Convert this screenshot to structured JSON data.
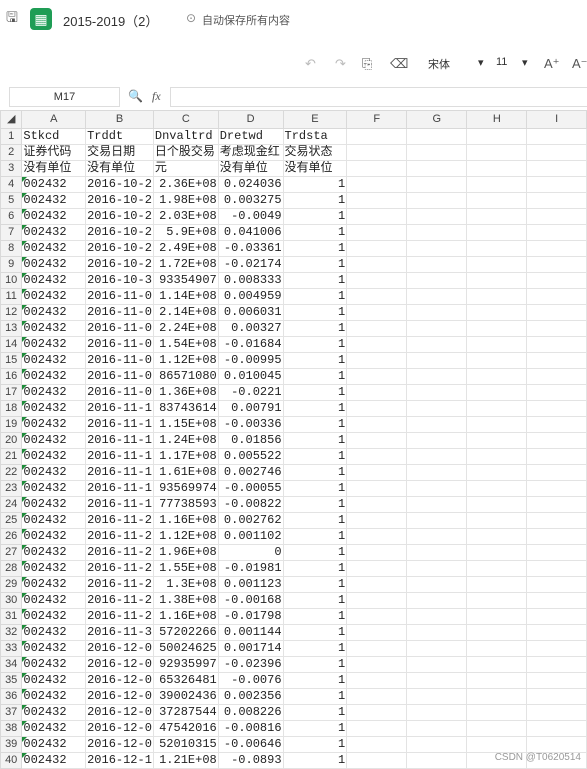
{
  "titlebar": {
    "doc_title": "2015-2019（2）",
    "autosave": "自动保存所有内容"
  },
  "toolbar": {
    "font_name": "宋体",
    "font_size": "11"
  },
  "formula": {
    "cell_ref": "M17",
    "fx": "fx"
  },
  "columns": [
    "A",
    "B",
    "C",
    "D",
    "E",
    "F",
    "G",
    "H",
    "I"
  ],
  "rows": [
    {
      "n": "1",
      "a": "Stkcd",
      "b": "Trddt",
      "c": "Dnvaltrd",
      "d": "Dretwd",
      "e": "Trdsta"
    },
    {
      "n": "2",
      "a": "证券代码",
      "b": "交易日期",
      "c": "日个股交易",
      "d": "考虑现金红",
      "e": "交易状态"
    },
    {
      "n": "3",
      "a": "没有单位",
      "b": "没有单位",
      "c": "元",
      "d": "没有单位",
      "e": "没有单位"
    },
    {
      "n": "4",
      "a": "002432",
      "b": "2016-10-2",
      "c": "2.36E+08",
      "d": "0.024036",
      "e": "1"
    },
    {
      "n": "5",
      "a": "002432",
      "b": "2016-10-2",
      "c": "1.98E+08",
      "d": "0.003275",
      "e": "1"
    },
    {
      "n": "6",
      "a": "002432",
      "b": "2016-10-2",
      "c": "2.03E+08",
      "d": "-0.0049",
      "e": "1"
    },
    {
      "n": "7",
      "a": "002432",
      "b": "2016-10-2",
      "c": "5.9E+08",
      "d": "0.041006",
      "e": "1"
    },
    {
      "n": "8",
      "a": "002432",
      "b": "2016-10-2",
      "c": "2.49E+08",
      "d": "-0.03361",
      "e": "1"
    },
    {
      "n": "9",
      "a": "002432",
      "b": "2016-10-2",
      "c": "1.72E+08",
      "d": "-0.02174",
      "e": "1"
    },
    {
      "n": "10",
      "a": "002432",
      "b": "2016-10-3",
      "c": "93354907",
      "d": "0.008333",
      "e": "1"
    },
    {
      "n": "11",
      "a": "002432",
      "b": "2016-11-0",
      "c": "1.14E+08",
      "d": "0.004959",
      "e": "1"
    },
    {
      "n": "12",
      "a": "002432",
      "b": "2016-11-0",
      "c": "2.14E+08",
      "d": "0.006031",
      "e": "1"
    },
    {
      "n": "13",
      "a": "002432",
      "b": "2016-11-0",
      "c": "2.24E+08",
      "d": "0.00327",
      "e": "1"
    },
    {
      "n": "14",
      "a": "002432",
      "b": "2016-11-0",
      "c": "1.54E+08",
      "d": "-0.01684",
      "e": "1"
    },
    {
      "n": "15",
      "a": "002432",
      "b": "2016-11-0",
      "c": "1.12E+08",
      "d": "-0.00995",
      "e": "1"
    },
    {
      "n": "16",
      "a": "002432",
      "b": "2016-11-0",
      "c": "86571080",
      "d": "0.010045",
      "e": "1"
    },
    {
      "n": "17",
      "a": "002432",
      "b": "2016-11-0",
      "c": "1.36E+08",
      "d": "-0.0221",
      "e": "1"
    },
    {
      "n": "18",
      "a": "002432",
      "b": "2016-11-1",
      "c": "83743614",
      "d": "0.00791",
      "e": "1"
    },
    {
      "n": "19",
      "a": "002432",
      "b": "2016-11-1",
      "c": "1.15E+08",
      "d": "-0.00336",
      "e": "1"
    },
    {
      "n": "20",
      "a": "002432",
      "b": "2016-11-1",
      "c": "1.24E+08",
      "d": "0.01856",
      "e": "1"
    },
    {
      "n": "21",
      "a": "002432",
      "b": "2016-11-1",
      "c": "1.17E+08",
      "d": "0.005522",
      "e": "1"
    },
    {
      "n": "22",
      "a": "002432",
      "b": "2016-11-1",
      "c": "1.61E+08",
      "d": "0.002746",
      "e": "1"
    },
    {
      "n": "23",
      "a": "002432",
      "b": "2016-11-1",
      "c": "93569974",
      "d": "-0.00055",
      "e": "1"
    },
    {
      "n": "24",
      "a": "002432",
      "b": "2016-11-1",
      "c": "77738593",
      "d": "-0.00822",
      "e": "1"
    },
    {
      "n": "25",
      "a": "002432",
      "b": "2016-11-2",
      "c": "1.16E+08",
      "d": "0.002762",
      "e": "1"
    },
    {
      "n": "26",
      "a": "002432",
      "b": "2016-11-2",
      "c": "1.12E+08",
      "d": "0.001102",
      "e": "1"
    },
    {
      "n": "27",
      "a": "002432",
      "b": "2016-11-2",
      "c": "1.96E+08",
      "d": "0",
      "e": "1"
    },
    {
      "n": "28",
      "a": "002432",
      "b": "2016-11-2",
      "c": "1.55E+08",
      "d": "-0.01981",
      "e": "1"
    },
    {
      "n": "29",
      "a": "002432",
      "b": "2016-11-2",
      "c": "1.3E+08",
      "d": "0.001123",
      "e": "1"
    },
    {
      "n": "30",
      "a": "002432",
      "b": "2016-11-2",
      "c": "1.38E+08",
      "d": "-0.00168",
      "e": "1"
    },
    {
      "n": "31",
      "a": "002432",
      "b": "2016-11-2",
      "c": "1.16E+08",
      "d": "-0.01798",
      "e": "1"
    },
    {
      "n": "32",
      "a": "002432",
      "b": "2016-11-3",
      "c": "57202266",
      "d": "0.001144",
      "e": "1"
    },
    {
      "n": "33",
      "a": "002432",
      "b": "2016-12-0",
      "c": "50024625",
      "d": "0.001714",
      "e": "1"
    },
    {
      "n": "34",
      "a": "002432",
      "b": "2016-12-0",
      "c": "92935997",
      "d": "-0.02396",
      "e": "1"
    },
    {
      "n": "35",
      "a": "002432",
      "b": "2016-12-0",
      "c": "65326481",
      "d": "-0.0076",
      "e": "1"
    },
    {
      "n": "36",
      "a": "002432",
      "b": "2016-12-0",
      "c": "39002436",
      "d": "0.002356",
      "e": "1"
    },
    {
      "n": "37",
      "a": "002432",
      "b": "2016-12-0",
      "c": "37287544",
      "d": "0.008226",
      "e": "1"
    },
    {
      "n": "38",
      "a": "002432",
      "b": "2016-12-0",
      "c": "47542016",
      "d": "-0.00816",
      "e": "1"
    },
    {
      "n": "39",
      "a": "002432",
      "b": "2016-12-0",
      "c": "52010315",
      "d": "-0.00646",
      "e": "1"
    },
    {
      "n": "40",
      "a": "002432",
      "b": "2016-12-1",
      "c": "1.21E+08",
      "d": "-0.0893",
      "e": "1"
    }
  ],
  "watermark": "CSDN @T0620514"
}
